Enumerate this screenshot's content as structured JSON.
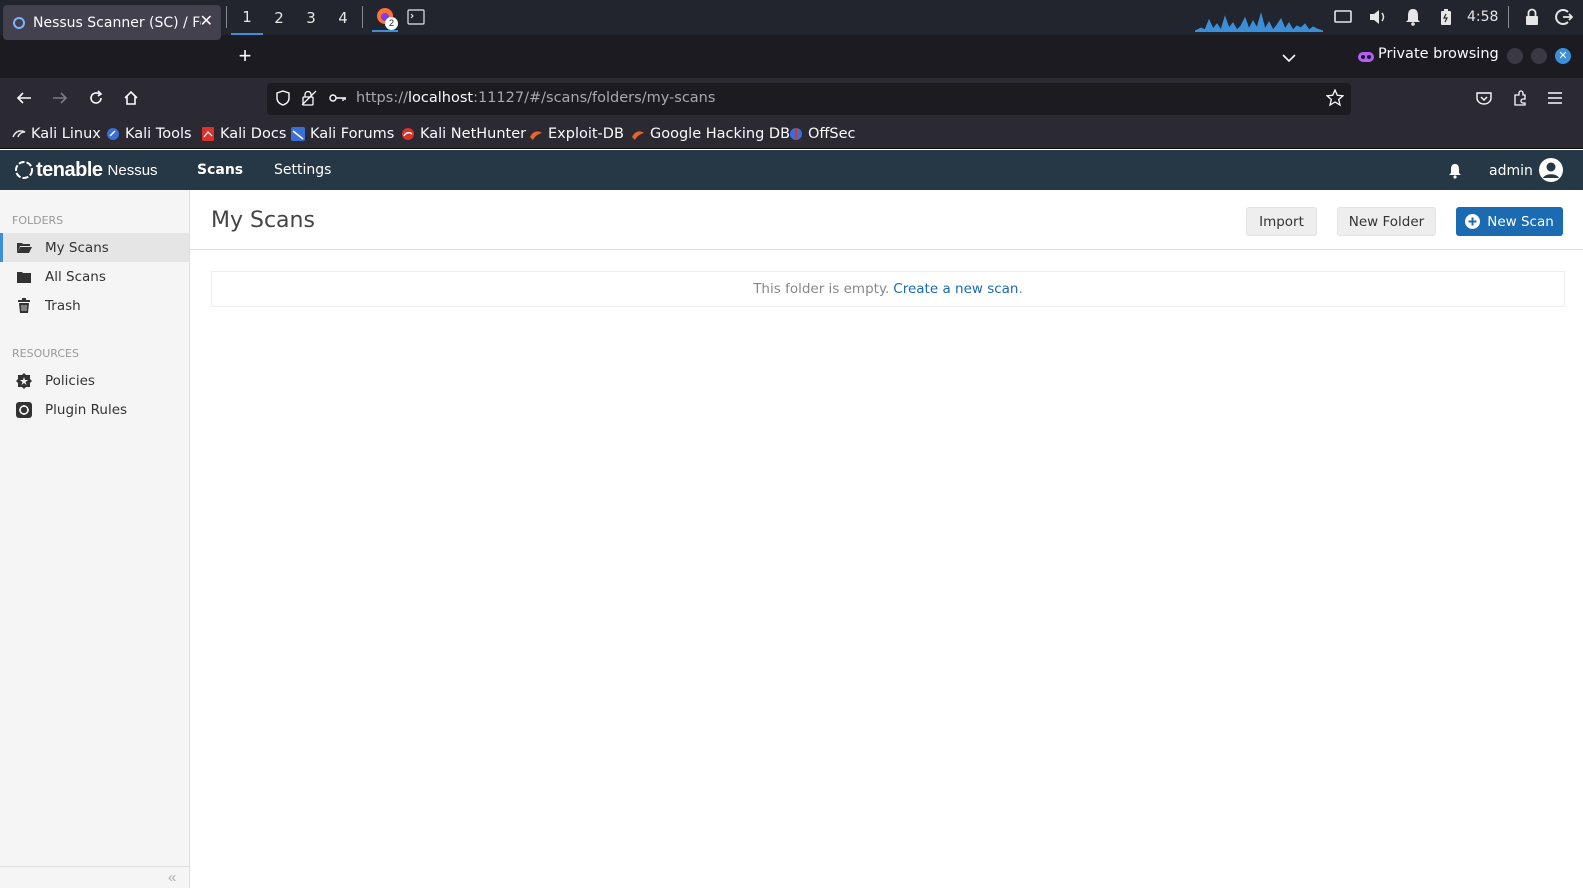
{
  "taskbar": {
    "workspaces": [
      "1",
      "2",
      "3",
      "4"
    ],
    "active_workspace": "1",
    "firefox_badge": "2",
    "clock": "4:58",
    "icons": [
      "kali-menu-icon",
      "desktop-icon",
      "file-manager-icon",
      "text-editor-icon",
      "firefox-icon",
      "terminal-icon",
      "chevron-down-icon",
      "network-graph-icon",
      "display-icon",
      "volume-icon",
      "notifications-icon",
      "battery-icon",
      "lock-icon",
      "logout-icon"
    ]
  },
  "browser": {
    "tab_title": "Nessus Scanner (SC) / Fol",
    "private_label": "Private browsing",
    "url_prefix": "https://",
    "url_host": "localhost",
    "url_rest": ":11127/#/scans/folders/my-scans",
    "bookmarks": [
      "Kali Linux",
      "Kali Tools",
      "Kali Docs",
      "Kali Forums",
      "Kali NetHunter",
      "Exploit-DB",
      "Google Hacking DB",
      "OffSec"
    ]
  },
  "nessus": {
    "logo_brand": "tenable",
    "logo_product": "Nessus",
    "nav": {
      "scans": "Scans",
      "settings": "Settings"
    },
    "user": "admin"
  },
  "sidebar": {
    "folders_heading": "FOLDERS",
    "folders": [
      {
        "label": "My Scans",
        "icon": "folder-open-icon",
        "active": true
      },
      {
        "label": "All Scans",
        "icon": "folder-icon",
        "active": false
      },
      {
        "label": "Trash",
        "icon": "trash-icon",
        "active": false
      }
    ],
    "resources_heading": "RESOURCES",
    "resources": [
      {
        "label": "Policies",
        "icon": "policy-badge-icon"
      },
      {
        "label": "Plugin Rules",
        "icon": "plugin-rules-icon"
      }
    ]
  },
  "main": {
    "title": "My Scans",
    "buttons": {
      "import": "Import",
      "new_folder": "New Folder",
      "new_scan": "New Scan"
    },
    "empty_text": "This folder is empty.",
    "empty_link": "Create a new scan",
    "empty_period": "."
  },
  "colors": {
    "nessus_header": "#263746",
    "accent_blue": "#1a6bb2",
    "taskbar": "#23252e",
    "browser_chrome": "#2b2a33"
  }
}
